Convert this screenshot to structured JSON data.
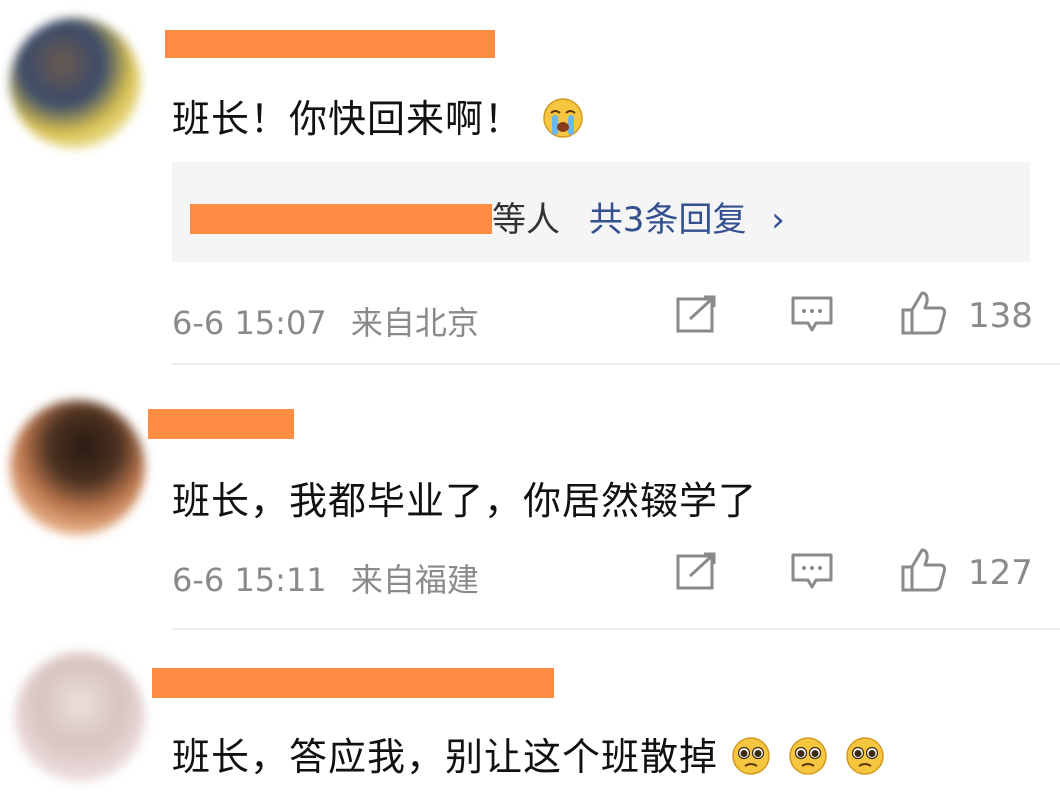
{
  "comments": [
    {
      "body": "班长！你快回来啊！",
      "emoji": "crying-face",
      "reply_box": {
        "names_suffix": "等人",
        "reply_count": "共3条回复",
        "chevron": "›"
      },
      "timestamp": "6-6 15:07",
      "location": "来自北京",
      "likes": "138"
    },
    {
      "body": "班长，我都毕业了，你居然辍学了",
      "timestamp": "6-6 15:11",
      "location": "来自福建",
      "likes": "127"
    },
    {
      "body": "班长，答应我，别让这个班散掉",
      "emoji": "pleading-face"
    }
  ],
  "colors": {
    "redaction": "#ff8c42",
    "link_blue": "#34508f",
    "meta_gray": "#8a8a8a",
    "reply_bg": "#f5f5f5"
  }
}
